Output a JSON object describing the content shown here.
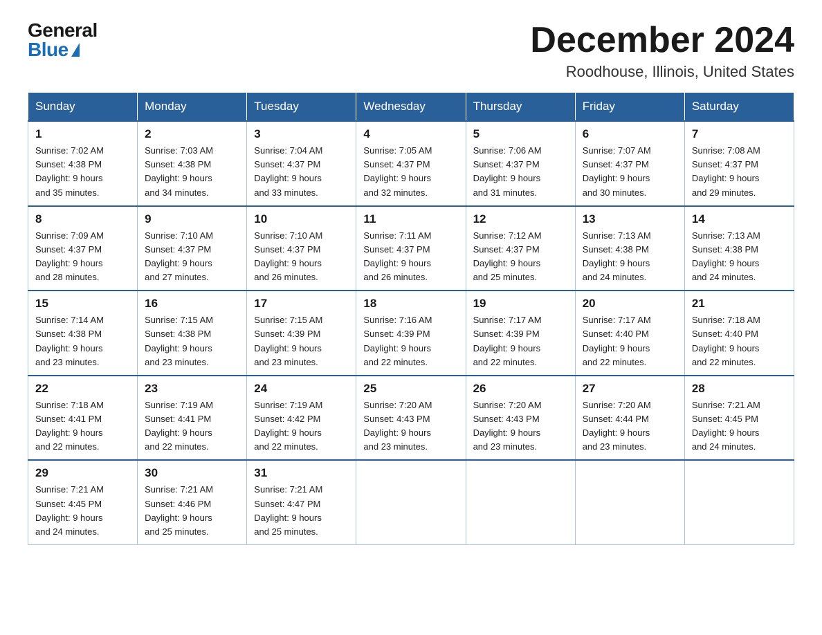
{
  "logo": {
    "general": "General",
    "blue": "Blue"
  },
  "header": {
    "month_year": "December 2024",
    "location": "Roodhouse, Illinois, United States"
  },
  "days_of_week": [
    "Sunday",
    "Monday",
    "Tuesday",
    "Wednesday",
    "Thursday",
    "Friday",
    "Saturday"
  ],
  "weeks": [
    [
      {
        "day": "1",
        "sunrise": "7:02 AM",
        "sunset": "4:38 PM",
        "daylight": "9 hours and 35 minutes."
      },
      {
        "day": "2",
        "sunrise": "7:03 AM",
        "sunset": "4:38 PM",
        "daylight": "9 hours and 34 minutes."
      },
      {
        "day": "3",
        "sunrise": "7:04 AM",
        "sunset": "4:37 PM",
        "daylight": "9 hours and 33 minutes."
      },
      {
        "day": "4",
        "sunrise": "7:05 AM",
        "sunset": "4:37 PM",
        "daylight": "9 hours and 32 minutes."
      },
      {
        "day": "5",
        "sunrise": "7:06 AM",
        "sunset": "4:37 PM",
        "daylight": "9 hours and 31 minutes."
      },
      {
        "day": "6",
        "sunrise": "7:07 AM",
        "sunset": "4:37 PM",
        "daylight": "9 hours and 30 minutes."
      },
      {
        "day": "7",
        "sunrise": "7:08 AM",
        "sunset": "4:37 PM",
        "daylight": "9 hours and 29 minutes."
      }
    ],
    [
      {
        "day": "8",
        "sunrise": "7:09 AM",
        "sunset": "4:37 PM",
        "daylight": "9 hours and 28 minutes."
      },
      {
        "day": "9",
        "sunrise": "7:10 AM",
        "sunset": "4:37 PM",
        "daylight": "9 hours and 27 minutes."
      },
      {
        "day": "10",
        "sunrise": "7:10 AM",
        "sunset": "4:37 PM",
        "daylight": "9 hours and 26 minutes."
      },
      {
        "day": "11",
        "sunrise": "7:11 AM",
        "sunset": "4:37 PM",
        "daylight": "9 hours and 26 minutes."
      },
      {
        "day": "12",
        "sunrise": "7:12 AM",
        "sunset": "4:37 PM",
        "daylight": "9 hours and 25 minutes."
      },
      {
        "day": "13",
        "sunrise": "7:13 AM",
        "sunset": "4:38 PM",
        "daylight": "9 hours and 24 minutes."
      },
      {
        "day": "14",
        "sunrise": "7:13 AM",
        "sunset": "4:38 PM",
        "daylight": "9 hours and 24 minutes."
      }
    ],
    [
      {
        "day": "15",
        "sunrise": "7:14 AM",
        "sunset": "4:38 PM",
        "daylight": "9 hours and 23 minutes."
      },
      {
        "day": "16",
        "sunrise": "7:15 AM",
        "sunset": "4:38 PM",
        "daylight": "9 hours and 23 minutes."
      },
      {
        "day": "17",
        "sunrise": "7:15 AM",
        "sunset": "4:39 PM",
        "daylight": "9 hours and 23 minutes."
      },
      {
        "day": "18",
        "sunrise": "7:16 AM",
        "sunset": "4:39 PM",
        "daylight": "9 hours and 22 minutes."
      },
      {
        "day": "19",
        "sunrise": "7:17 AM",
        "sunset": "4:39 PM",
        "daylight": "9 hours and 22 minutes."
      },
      {
        "day": "20",
        "sunrise": "7:17 AM",
        "sunset": "4:40 PM",
        "daylight": "9 hours and 22 minutes."
      },
      {
        "day": "21",
        "sunrise": "7:18 AM",
        "sunset": "4:40 PM",
        "daylight": "9 hours and 22 minutes."
      }
    ],
    [
      {
        "day": "22",
        "sunrise": "7:18 AM",
        "sunset": "4:41 PM",
        "daylight": "9 hours and 22 minutes."
      },
      {
        "day": "23",
        "sunrise": "7:19 AM",
        "sunset": "4:41 PM",
        "daylight": "9 hours and 22 minutes."
      },
      {
        "day": "24",
        "sunrise": "7:19 AM",
        "sunset": "4:42 PM",
        "daylight": "9 hours and 22 minutes."
      },
      {
        "day": "25",
        "sunrise": "7:20 AM",
        "sunset": "4:43 PM",
        "daylight": "9 hours and 23 minutes."
      },
      {
        "day": "26",
        "sunrise": "7:20 AM",
        "sunset": "4:43 PM",
        "daylight": "9 hours and 23 minutes."
      },
      {
        "day": "27",
        "sunrise": "7:20 AM",
        "sunset": "4:44 PM",
        "daylight": "9 hours and 23 minutes."
      },
      {
        "day": "28",
        "sunrise": "7:21 AM",
        "sunset": "4:45 PM",
        "daylight": "9 hours and 24 minutes."
      }
    ],
    [
      {
        "day": "29",
        "sunrise": "7:21 AM",
        "sunset": "4:45 PM",
        "daylight": "9 hours and 24 minutes."
      },
      {
        "day": "30",
        "sunrise": "7:21 AM",
        "sunset": "4:46 PM",
        "daylight": "9 hours and 25 minutes."
      },
      {
        "day": "31",
        "sunrise": "7:21 AM",
        "sunset": "4:47 PM",
        "daylight": "9 hours and 25 minutes."
      },
      null,
      null,
      null,
      null
    ]
  ],
  "labels": {
    "sunrise": "Sunrise: ",
    "sunset": "Sunset: ",
    "daylight": "Daylight: "
  }
}
